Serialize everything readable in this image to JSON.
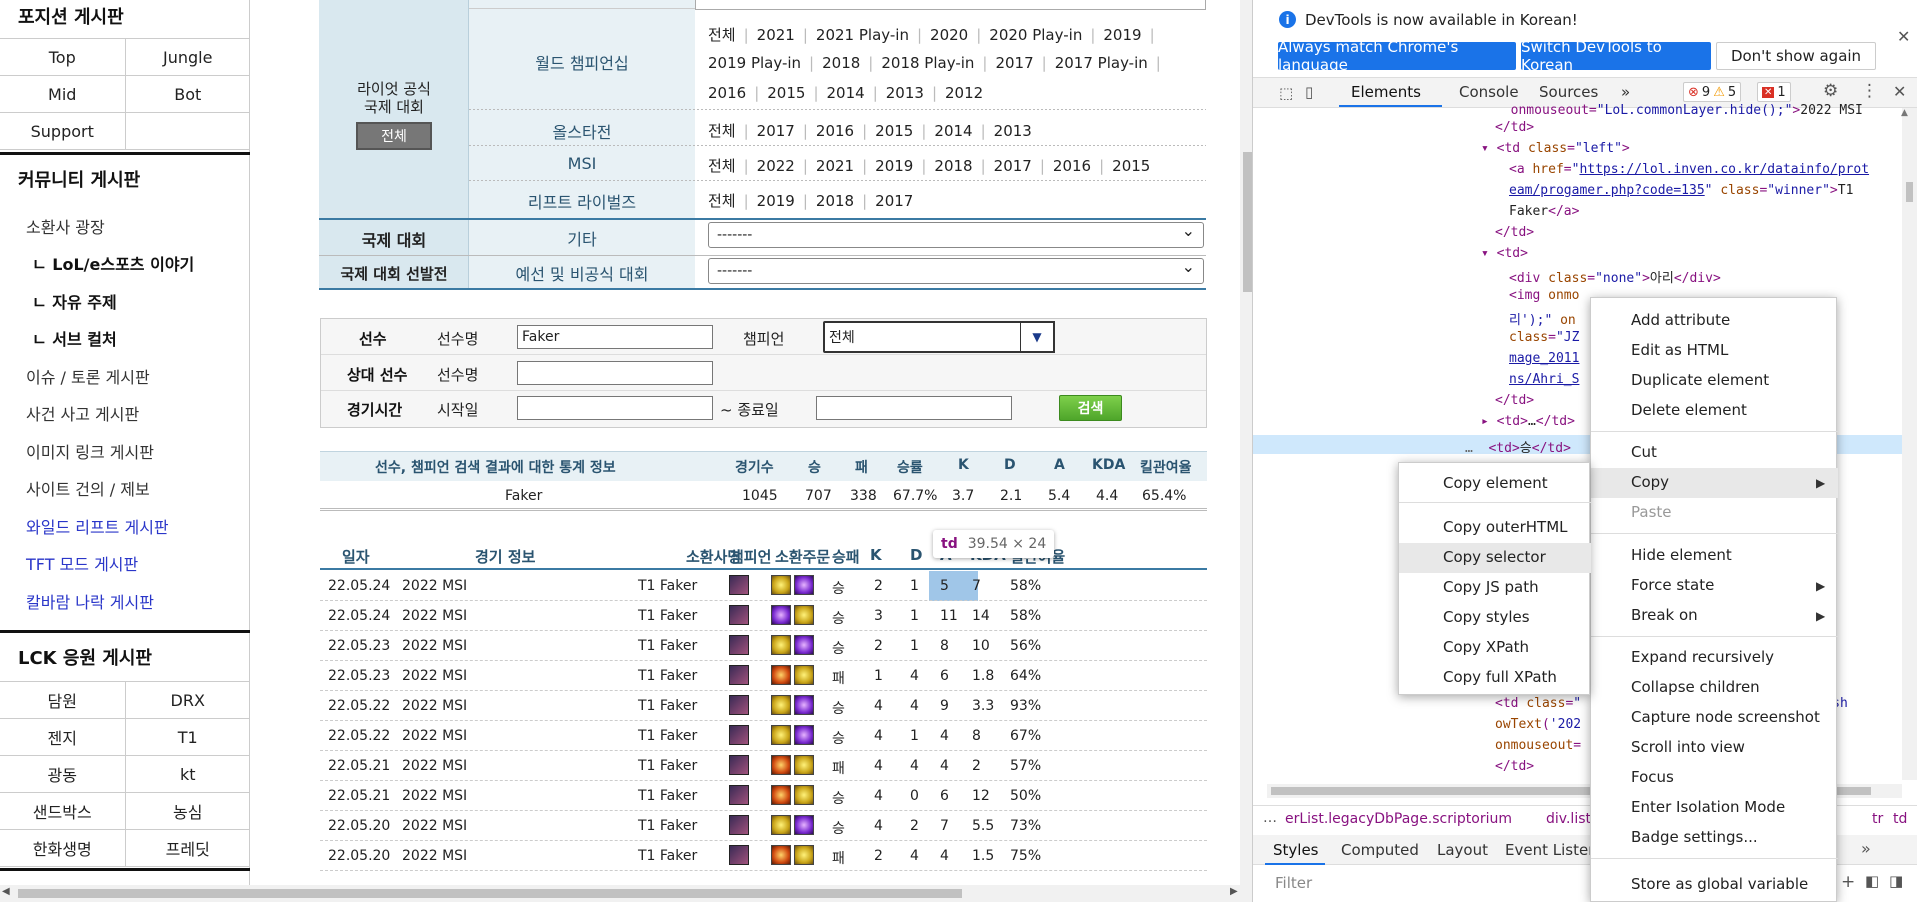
{
  "sidebar": {
    "position_title": "포지션 게시판",
    "position_items": [
      [
        "Top",
        "Jungle"
      ],
      [
        "Mid",
        "Bot"
      ],
      [
        "Support",
        ""
      ]
    ],
    "community_title": "커뮤니티 게시판",
    "community_items": [
      "소환사 광장",
      "ㄴ LoL/e스포츠 이야기",
      "ㄴ 자유 주제",
      "ㄴ 서브 컬처",
      "이슈 / 토론 게시판",
      "사건 사고 게시판",
      "이미지 링크 게시판",
      "사이트 건의 / 제보",
      "와일드 리프트 게시판",
      "TFT 모드 게시판",
      "칼바람 나락 게시판"
    ],
    "lck_title": "LCK 응원 게시판",
    "lck_items": [
      [
        "담원",
        "DRX"
      ],
      [
        "젠지",
        "T1"
      ],
      [
        "광동",
        "kt"
      ],
      [
        "샌드박스",
        "농심"
      ],
      [
        "한화생명",
        "프레딧"
      ]
    ]
  },
  "tournaments": {
    "riot_label_line1": "라이엇 공식",
    "riot_label_line2": "국제 대회",
    "all_button": "전체",
    "worlds_label": "월드 챔피언십",
    "worlds_line1": [
      "전체",
      "2021",
      "2021 Play-in",
      "2020",
      "2020 Play-in",
      "2019"
    ],
    "worlds_line2": [
      "2019 Play-in",
      "2018",
      "2018 Play-in",
      "2017",
      "2017 Play-in"
    ],
    "worlds_line3": [
      "2016",
      "2015",
      "2014",
      "2013",
      "2012"
    ],
    "allstar_label": "올스타전",
    "allstar_items": [
      "전체",
      "2017",
      "2016",
      "2015",
      "2014",
      "2013"
    ],
    "msi_label": "MSI",
    "msi_items": [
      "전체",
      "2022",
      "2021",
      "2019",
      "2018",
      "2017",
      "2016",
      "2015"
    ],
    "rift_label": "리프트 라이벌즈",
    "rift_items": [
      "전체",
      "2019",
      "2018",
      "2017"
    ],
    "intl_label": "국제 대회",
    "other_label": "기타",
    "other_select": "-------",
    "qual_label": "국제 대회 선발전",
    "qual_sub": "예선 및 비공식 대회",
    "qual_select": "-------"
  },
  "search": {
    "player_label": "선수",
    "player_name_label": "선수명",
    "player_name_value": "Faker",
    "champion_label": "챔피언",
    "champion_value": "전체",
    "opponent_label": "상대 선수",
    "opponent_name_label": "선수명",
    "time_label": "경기시간",
    "start_label": "시작일",
    "end_label": "~ 종료일",
    "search_button": "검색"
  },
  "stats": {
    "headers": [
      "선수, 챔피언 검색 결과에 대한 통계 정보",
      "경기수",
      "승",
      "패",
      "승률",
      "K",
      "D",
      "A",
      "KDA",
      "킬관여율"
    ],
    "values": [
      "Faker",
      "1045",
      "707",
      "338",
      "67.7%",
      "3.7",
      "2.1",
      "5.4",
      "4.4",
      "65.4%"
    ]
  },
  "games": {
    "headers": [
      "일자",
      "경기 정보",
      "소환사명",
      "챔피언",
      "소환주문",
      "승패",
      "K",
      "D",
      "A",
      "KDA",
      "킬관여율"
    ],
    "rows": [
      [
        "22.05.24",
        "2022 MSI",
        "T1 Faker",
        "flash",
        "tp",
        "승",
        "2",
        "1",
        "5",
        "7",
        "58%"
      ],
      [
        "22.05.24",
        "2022 MSI",
        "T1 Faker",
        "tp",
        "flash",
        "승",
        "3",
        "1",
        "11",
        "14",
        "58%"
      ],
      [
        "22.05.23",
        "2022 MSI",
        "T1 Faker",
        "flash",
        "tp",
        "승",
        "2",
        "1",
        "8",
        "10",
        "56%"
      ],
      [
        "22.05.23",
        "2022 MSI",
        "T1 Faker",
        "ignite",
        "flash",
        "패",
        "1",
        "4",
        "6",
        "1.8",
        "64%"
      ],
      [
        "22.05.22",
        "2022 MSI",
        "T1 Faker",
        "flash",
        "tp",
        "승",
        "4",
        "4",
        "9",
        "3.3",
        "93%"
      ],
      [
        "22.05.22",
        "2022 MSI",
        "T1 Faker",
        "flash",
        "tp",
        "승",
        "4",
        "1",
        "4",
        "8",
        "67%"
      ],
      [
        "22.05.21",
        "2022 MSI",
        "T1 Faker",
        "ignite",
        "flash",
        "패",
        "4",
        "4",
        "4",
        "2",
        "57%"
      ],
      [
        "22.05.21",
        "2022 MSI",
        "T1 Faker",
        "ignite",
        "flash",
        "승",
        "4",
        "0",
        "6",
        "12",
        "50%"
      ],
      [
        "22.05.20",
        "2022 MSI",
        "T1 Faker",
        "flash",
        "tp",
        "승",
        "4",
        "2",
        "7",
        "5.5",
        "73%"
      ],
      [
        "22.05.20",
        "2022 MSI",
        "T1 Faker",
        "ignite",
        "flash",
        "패",
        "2",
        "4",
        "4",
        "1.5",
        "75%"
      ]
    ]
  },
  "tooltip": {
    "tag": "td",
    "size": "39.54 × 24"
  },
  "devtools": {
    "info_text": "DevTools is now available in Korean!",
    "btn_match": "Always match Chrome's language",
    "btn_switch": "Switch DevTools to Korean",
    "btn_dont": "Don't show again",
    "tabs": [
      "Elements",
      "Console",
      "Sources"
    ],
    "errors": "9",
    "warnings": "5",
    "issues": "1",
    "breadcrumb_a": "erList.legacyDbPage.scriptorium",
    "breadcrumb_b": "div.listTa",
    "breadcrumb_c": "tr",
    "breadcrumb_d": "td",
    "bottom_tabs": [
      "Styles",
      "Computed",
      "Layout",
      "Event Listen"
    ],
    "filter_placeholder": "Filter"
  },
  "context_menu": {
    "items": [
      "Add attribute",
      "Edit as HTML",
      "Duplicate element",
      "Delete element",
      "Cut",
      "Copy",
      "Paste",
      "Hide element",
      "Force state",
      "Break on",
      "Expand recursively",
      "Collapse children",
      "Capture node screenshot",
      "Scroll into view",
      "Focus",
      "Enter Isolation Mode",
      "Badge settings...",
      "Store as global variable"
    ],
    "copy_items": [
      "Copy element",
      "Copy outerHTML",
      "Copy selector",
      "Copy JS path",
      "Copy styles",
      "Copy XPath",
      "Copy full XPath"
    ]
  }
}
